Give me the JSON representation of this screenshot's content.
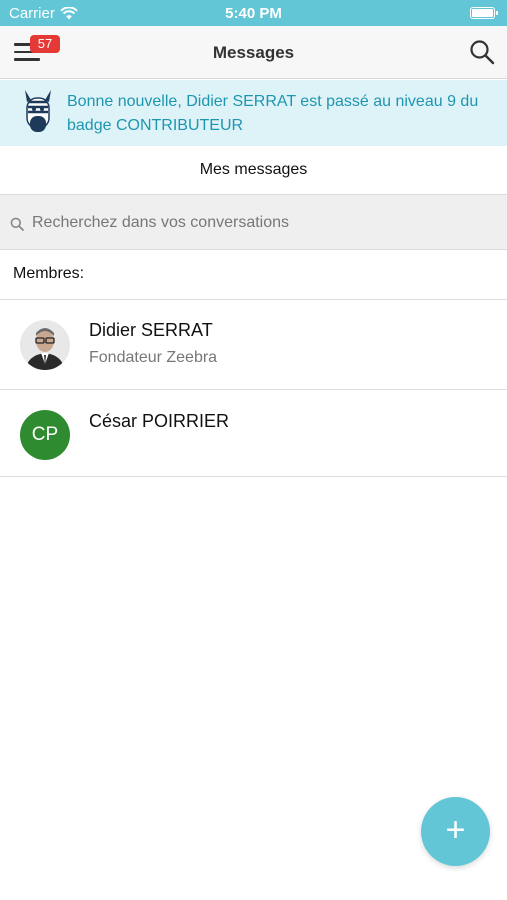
{
  "status_bar": {
    "carrier": "Carrier",
    "time": "5:40 PM"
  },
  "nav": {
    "title": "Messages",
    "badge_count": "57"
  },
  "banner": {
    "text": "Bonne nouvelle, Didier SERRAT est passé au niveau 9 du badge CONTRIBUTEUR"
  },
  "section_title": "Mes messages",
  "search": {
    "placeholder": "Recherchez dans vos conversations",
    "value": ""
  },
  "members": {
    "label": "Membres:",
    "items": [
      {
        "name": "Didier SERRAT",
        "role": "Fondateur Zeebra",
        "avatar": "photo"
      },
      {
        "name": "César POIRRIER",
        "role": "",
        "initials": "CP",
        "avatar_color": "#2e8b2f"
      }
    ]
  },
  "fab": {
    "label": "+"
  },
  "colors": {
    "accent": "#63c6d6",
    "banner_bg": "#def3f8",
    "banner_text": "#1e96b0",
    "badge": "#e53935"
  }
}
